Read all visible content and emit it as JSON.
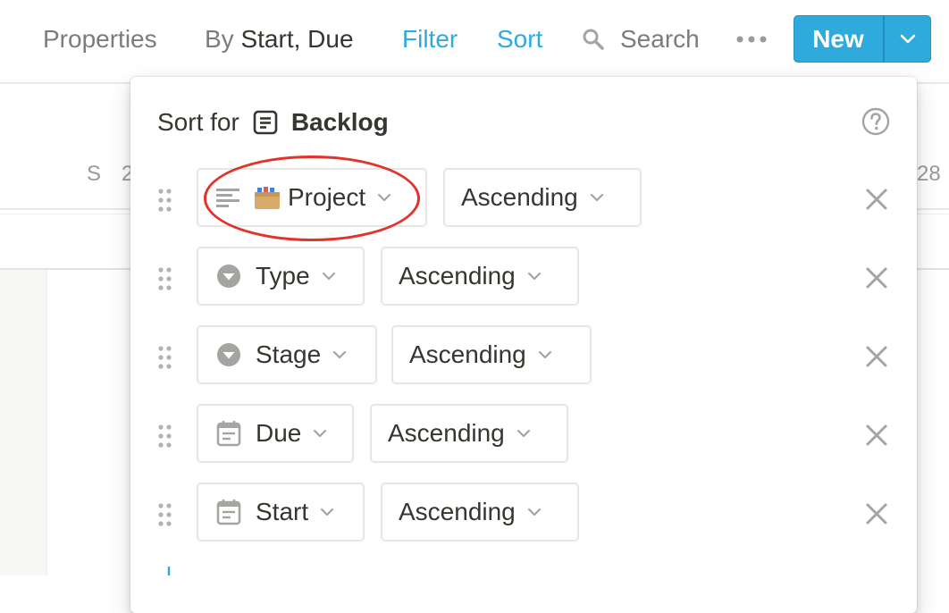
{
  "toolbar": {
    "properties_label": "Properties",
    "group_prefix": "By",
    "group_value": "Start, Due",
    "filter_label": "Filter",
    "sort_label": "Sort",
    "search_label": "Search",
    "new_label": "New",
    "search_icon": "search-icon",
    "more_icon": "more-horizontal-icon",
    "caret_icon": "chevron-down-icon"
  },
  "background": {
    "weekday": "S",
    "day_start_partial": "2",
    "day_end_partial": "28"
  },
  "sort_popover": {
    "title_prefix": "Sort for",
    "database_name": "Backlog",
    "database_icon": "database-page-icon",
    "help_icon": "question-circle-icon",
    "rules": [
      {
        "property": "Project",
        "property_icon": "text-lines-icon",
        "emoji": "card-file-box-emoji",
        "direction": "Ascending",
        "highlighted": true
      },
      {
        "property": "Type",
        "property_icon": "select-circle-icon",
        "direction": "Ascending",
        "highlighted": false
      },
      {
        "property": "Stage",
        "property_icon": "select-circle-icon",
        "direction": "Ascending",
        "highlighted": false
      },
      {
        "property": "Due",
        "property_icon": "calendar-icon",
        "direction": "Ascending",
        "highlighted": false
      },
      {
        "property": "Start",
        "property_icon": "calendar-icon",
        "direction": "Ascending",
        "highlighted": false
      }
    ]
  },
  "colors": {
    "accent_blue": "#2eaadc",
    "text_primary": "#37352f",
    "text_muted": "#7d7c78",
    "annotation_red": "#e2332a"
  }
}
